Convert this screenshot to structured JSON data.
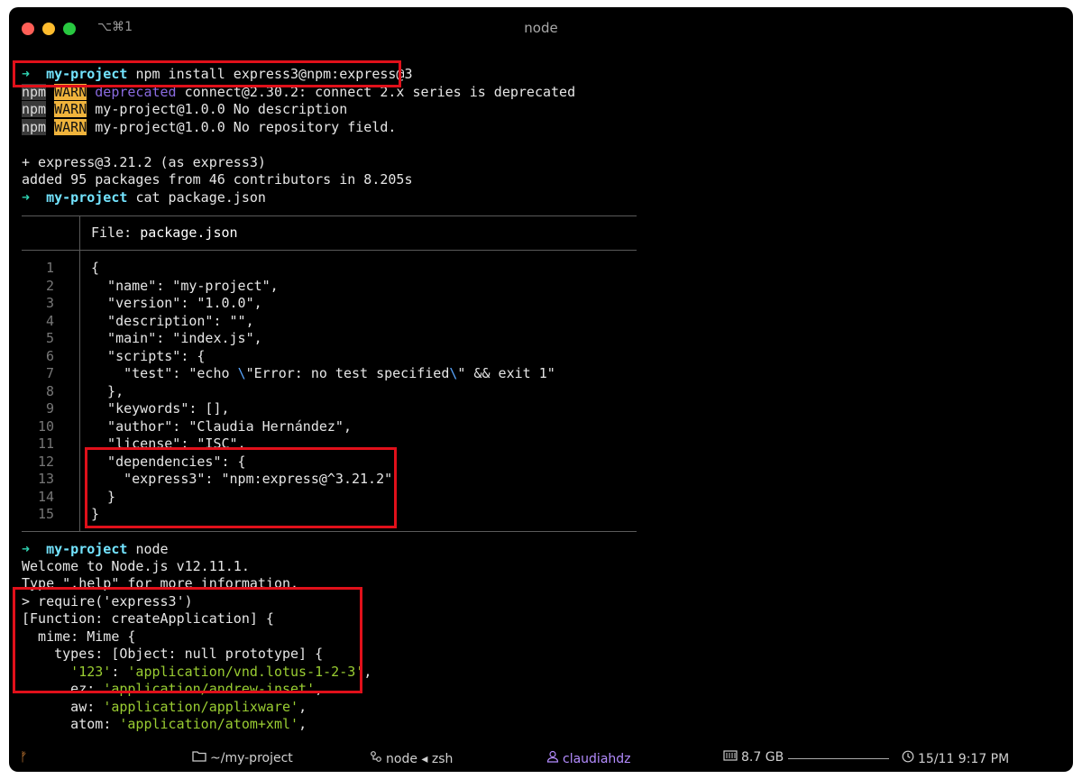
{
  "window": {
    "tab_shortcut": "⌥⌘1",
    "title": "node"
  },
  "terminal": {
    "prompt_arrow": "➜",
    "prompt_dir": "my-project",
    "cmd1": "npm install express3@npm:express@3",
    "warn1": {
      "npm": "npm",
      "warn": "WARN",
      "deprecated": "deprecated",
      "text": " connect@2.30.2: connect 2.x series is deprecated"
    },
    "warn2": {
      "npm": "npm",
      "warn": "WARN",
      "text": " my-project@1.0.0 No description"
    },
    "warn3": {
      "npm": "npm",
      "warn": "WARN",
      "text": " my-project@1.0.0 No repository field."
    },
    "added_pkg": "+ express@3.21.2 (as express3)",
    "added_summary": "added 95 packages from 46 contributors in 8.205s",
    "cmd2": "cat package.json",
    "file_label": "File: ",
    "file_name": "package.json",
    "line_numbers": [
      "1",
      "2",
      "3",
      "4",
      "5",
      "6",
      "7",
      "8",
      "9",
      "10",
      "11",
      "12",
      "13",
      "14",
      "15"
    ],
    "code_lines": [
      "{",
      "  \"name\": \"my-project\",",
      "  \"version\": \"1.0.0\",",
      "  \"description\": \"\",",
      "  \"main\": \"index.js\",",
      "  \"scripts\": {",
      "    \"test\": \"echo ",
      "  },",
      "  \"keywords\": [],",
      "  \"author\": \"Claudia Hernández\",",
      "  \"license\": \"ISC\",",
      "  \"dependencies\": {",
      "    \"express3\": \"npm:express@^3.21.2\"",
      "  }",
      "}"
    ],
    "code_line7": {
      "pre": "    \"test\": \"echo ",
      "esc1": "\\",
      "mid": "\"Error: no test specified",
      "esc2": "\\",
      "post": "\" && exit 1\""
    },
    "cmd3": "node",
    "node_welcome": "Welcome to Node.js v12.11.1.",
    "node_help": "Type \".help\" for more information.",
    "repl_input": "> require('express3')",
    "repl_out1": "[Function: createApplication] {",
    "repl_out2": "  mime: Mime {",
    "repl_out3": "    types: [Object: null prototype] {",
    "repl_out4_key": "      '123'",
    "repl_out4_sep": ": ",
    "repl_out4_val": "'application/vnd.lotus-1-2-3'",
    "repl_out4_end": ",",
    "repl_out5_key": "      ez",
    "repl_out5_val": "'application/andrew-inset'",
    "repl_out6_key": "      aw",
    "repl_out6_val": "'application/applixware'",
    "repl_out7_key": "      atom",
    "repl_out7_val": "'application/atom+xml'"
  },
  "statusbar": {
    "branch_icon": "ᚠ",
    "dir": "~/my-project",
    "process": "node ◂ zsh",
    "user": "claudiahdz",
    "memory": "8.7 GB",
    "time": "15/11 9:17 PM"
  },
  "colors": {
    "highlight": "#e0101a",
    "prompt_arrow": "#2fd3b2",
    "prompt_dir": "#73e4ff",
    "warn_bg": "#f0b43c",
    "string_green": "#9acd32"
  }
}
